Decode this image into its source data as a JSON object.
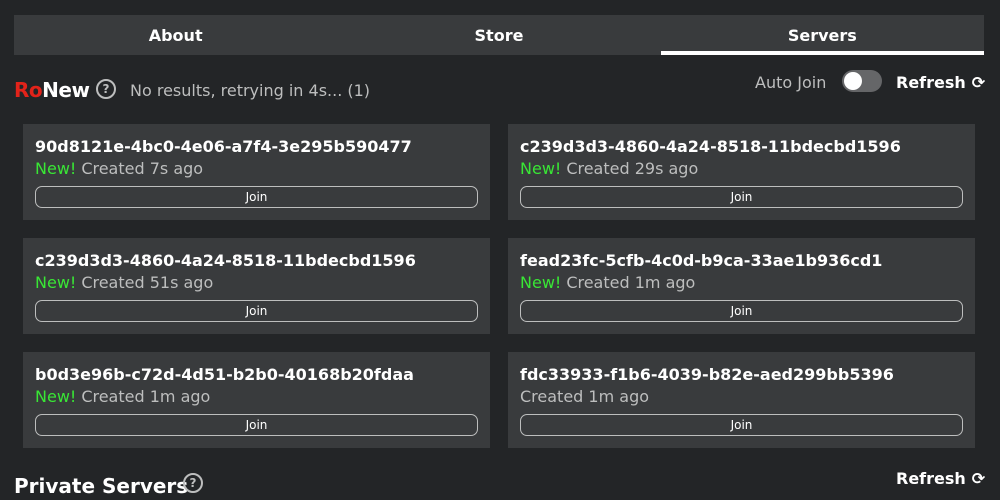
{
  "tabs": [
    {
      "label": "About",
      "active": false
    },
    {
      "label": "Store",
      "active": false
    },
    {
      "label": "Servers",
      "active": true
    }
  ],
  "header": {
    "brand_ro": "Ro",
    "brand_new": "New",
    "status": "No results, retrying in 4s... (1)",
    "auto_join_label": "Auto Join",
    "auto_join_on": false,
    "refresh_label": "Refresh"
  },
  "servers": [
    {
      "id": "90d8121e-4bc0-4e06-a7f4-3e295b590477",
      "new_label": "New!",
      "created": "Created 7s ago",
      "join_label": "Join"
    },
    {
      "id": "c239d3d3-4860-4a24-8518-11bdecbd1596",
      "new_label": "New!",
      "created": "Created 29s ago",
      "join_label": "Join"
    },
    {
      "id": "c239d3d3-4860-4a24-8518-11bdecbd1596",
      "new_label": "New!",
      "created": "Created 51s ago",
      "join_label": "Join"
    },
    {
      "id": "fead23fc-5cfb-4c0d-b9ca-33ae1b936cd1",
      "new_label": "New!",
      "created": "Created 1m ago",
      "join_label": "Join"
    },
    {
      "id": "b0d3e96b-c72d-4d51-b2b0-40168b20fdaa",
      "new_label": "New!",
      "created": "Created 1m ago",
      "join_label": "Join"
    },
    {
      "id": "fdc33933-f1b6-4039-b82e-aed299bb5396",
      "new_label": "",
      "created": "Created 1m ago",
      "join_label": "Join"
    }
  ],
  "private": {
    "title": "Private Servers",
    "refresh_label": "Refresh"
  },
  "colors": {
    "background": "#232527",
    "card": "#393b3d",
    "brand_red": "#e2231a",
    "new_green": "#39e635",
    "muted_text": "#bdbebe"
  },
  "icons": {
    "help": "question-circle-icon",
    "refresh": "refresh-icon"
  }
}
